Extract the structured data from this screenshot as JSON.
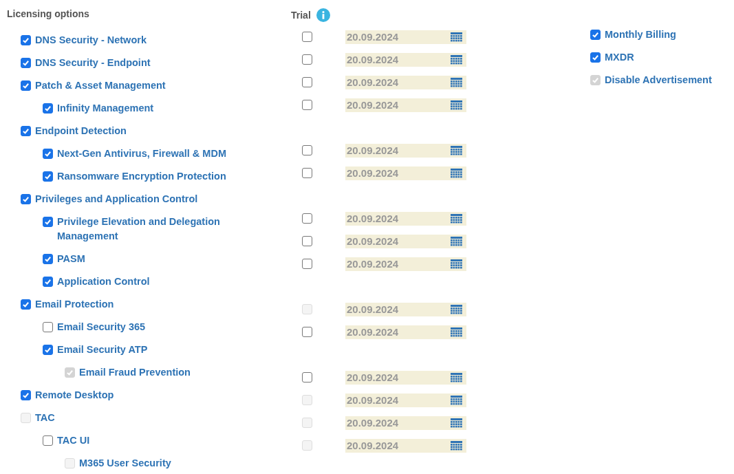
{
  "licensing": {
    "title": "Licensing options",
    "options": [
      {
        "label": "DNS Security - Network",
        "checked": true,
        "disabled": false
      },
      {
        "label": "DNS Security - Endpoint",
        "checked": true,
        "disabled": false
      },
      {
        "label": "Patch & Asset Management",
        "checked": true,
        "disabled": false,
        "children": [
          {
            "label": "Infinity Management",
            "checked": true,
            "disabled": false
          }
        ]
      },
      {
        "label": "Endpoint Detection",
        "checked": true,
        "disabled": false,
        "children": [
          {
            "label": "Next-Gen Antivirus, Firewall & MDM",
            "checked": true,
            "disabled": false
          },
          {
            "label": "Ransomware Encryption Protection",
            "checked": true,
            "disabled": false
          }
        ]
      },
      {
        "label": "Privileges and Application Control",
        "checked": true,
        "disabled": false,
        "children": [
          {
            "label": "Privilege Elevation and Delegation Management",
            "checked": true,
            "disabled": false
          },
          {
            "label": "PASM",
            "checked": true,
            "disabled": false
          },
          {
            "label": "Application Control",
            "checked": true,
            "disabled": false
          }
        ]
      },
      {
        "label": "Email Protection",
        "checked": true,
        "disabled": false,
        "children": [
          {
            "label": "Email Security 365",
            "checked": false,
            "disabled": false
          },
          {
            "label": "Email Security ATP",
            "checked": true,
            "disabled": false,
            "children": [
              {
                "label": "Email Fraud Prevention",
                "checked": true,
                "disabled": true
              }
            ]
          }
        ]
      },
      {
        "label": "Remote Desktop",
        "checked": true,
        "disabled": false
      },
      {
        "label": "TAC",
        "checked": false,
        "disabled": true,
        "children": [
          {
            "label": "TAC UI",
            "checked": false,
            "disabled": false,
            "children": [
              {
                "label": "M365 User Security",
                "checked": false,
                "disabled": true
              }
            ]
          }
        ]
      }
    ]
  },
  "trial": {
    "title": "Trial",
    "rows": [
      {
        "kind": "date",
        "checked": false,
        "disabled": false,
        "date": "20.09.2024"
      },
      {
        "kind": "date",
        "checked": false,
        "disabled": false,
        "date": "20.09.2024"
      },
      {
        "kind": "date",
        "checked": false,
        "disabled": false,
        "date": "20.09.2024"
      },
      {
        "kind": "date",
        "checked": false,
        "disabled": false,
        "date": "20.09.2024"
      },
      {
        "kind": "blank"
      },
      {
        "kind": "date",
        "checked": false,
        "disabled": false,
        "date": "20.09.2024"
      },
      {
        "kind": "date",
        "checked": false,
        "disabled": false,
        "date": "20.09.2024"
      },
      {
        "kind": "blank"
      },
      {
        "kind": "date",
        "checked": false,
        "disabled": false,
        "date": "20.09.2024"
      },
      {
        "kind": "date",
        "checked": false,
        "disabled": false,
        "date": "20.09.2024"
      },
      {
        "kind": "date",
        "checked": false,
        "disabled": false,
        "date": "20.09.2024"
      },
      {
        "kind": "blank"
      },
      {
        "kind": "date",
        "checked": false,
        "disabled": true,
        "date": "20.09.2024"
      },
      {
        "kind": "date",
        "checked": false,
        "disabled": false,
        "date": "20.09.2024"
      },
      {
        "kind": "blank"
      },
      {
        "kind": "date",
        "checked": false,
        "disabled": false,
        "date": "20.09.2024"
      },
      {
        "kind": "date",
        "checked": false,
        "disabled": true,
        "date": "20.09.2024"
      },
      {
        "kind": "date",
        "checked": false,
        "disabled": true,
        "date": "20.09.2024"
      },
      {
        "kind": "date",
        "checked": false,
        "disabled": true,
        "date": "20.09.2024"
      }
    ]
  },
  "settings": [
    {
      "label": "Monthly Billing",
      "checked": true,
      "disabled": false
    },
    {
      "label": "MXDR",
      "checked": true,
      "disabled": false
    },
    {
      "label": "Disable Advertisement",
      "checked": true,
      "disabled": true
    }
  ]
}
